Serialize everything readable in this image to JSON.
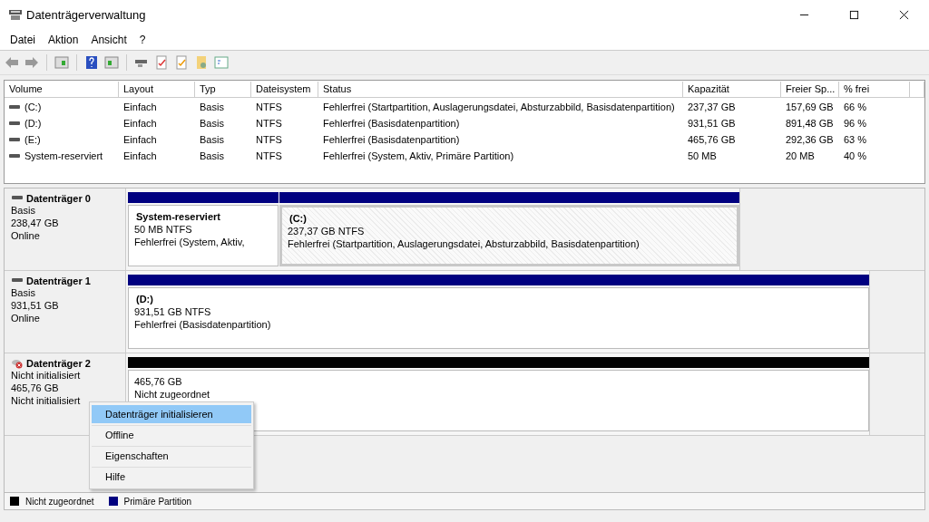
{
  "window": {
    "title": "Datenträgerverwaltung"
  },
  "menu": [
    {
      "label": "Datei"
    },
    {
      "label": "Aktion"
    },
    {
      "label": "Ansicht"
    },
    {
      "label": "?"
    }
  ],
  "table": {
    "columns": [
      "Volume",
      "Layout",
      "Typ",
      "Dateisystem",
      "Status",
      "Kapazität",
      "Freier Sp...",
      "% frei"
    ],
    "rows": [
      {
        "cells": [
          "(C:)",
          "Einfach",
          "Basis",
          "NTFS",
          "Fehlerfrei (Startpartition, Auslagerungsdatei, Absturzabbild, Basisdatenpartition)",
          "237,37 GB",
          "157,69 GB",
          "66 %"
        ]
      },
      {
        "cells": [
          "(D:)",
          "Einfach",
          "Basis",
          "NTFS",
          "Fehlerfrei (Basisdatenpartition)",
          "931,51 GB",
          "891,48 GB",
          "96 %"
        ]
      },
      {
        "cells": [
          "(E:)",
          "Einfach",
          "Basis",
          "NTFS",
          "Fehlerfrei (Basisdatenpartition)",
          "465,76 GB",
          "292,36 GB",
          "63 %"
        ]
      },
      {
        "cells": [
          "System-reserviert",
          "Einfach",
          "Basis",
          "NTFS",
          "Fehlerfrei (System, Aktiv, Primäre Partition)",
          "50 MB",
          "20 MB",
          "40 %"
        ]
      }
    ]
  },
  "disks": [
    {
      "name": "Datenträger 0",
      "kind": "online",
      "lines": [
        "Basis",
        "238,47 GB",
        "Online"
      ],
      "partitions": [
        {
          "kind": "primary",
          "selected": false,
          "title": "System-reserviert",
          "lines": [
            "50 MB NTFS",
            "Fehlerfrei (System, Aktiv,"
          ]
        },
        {
          "kind": "primary",
          "selected": true,
          "title": "(C:)",
          "lines": [
            "237,37 GB NTFS",
            "Fehlerfrei (Startpartition, Auslagerungsdatei, Absturzabbild, Basisdatenpartition)"
          ]
        }
      ]
    },
    {
      "name": "Datenträger 1",
      "kind": "online",
      "lines": [
        "Basis",
        "931,51 GB",
        "Online"
      ],
      "partitions": [
        {
          "kind": "primary",
          "selected": false,
          "title": "(D:)",
          "lines": [
            "931,51 GB NTFS",
            "Fehlerfrei (Basisdatenpartition)"
          ]
        }
      ]
    },
    {
      "name": "Datenträger 2",
      "kind": "not_initialized",
      "lines": [
        "Nicht initialisiert",
        "465,76 GB",
        "Nicht initialisiert"
      ],
      "partitions": [
        {
          "kind": "unallocated",
          "selected": false,
          "lines": [
            "465,76 GB",
            "Nicht zugeordnet"
          ]
        }
      ]
    }
  ],
  "context_menu": [
    {
      "label": "Datenträger initialisieren",
      "selected": true
    },
    {
      "label": "Offline",
      "selected": false
    },
    {
      "label": "Eigenschaften",
      "selected": false
    },
    {
      "label": "Hilfe",
      "selected": false
    }
  ],
  "legend": [
    {
      "label": "Nicht zugeordnet",
      "color": "#000000"
    },
    {
      "label": "Primäre Partition",
      "color": "#000080"
    }
  ]
}
